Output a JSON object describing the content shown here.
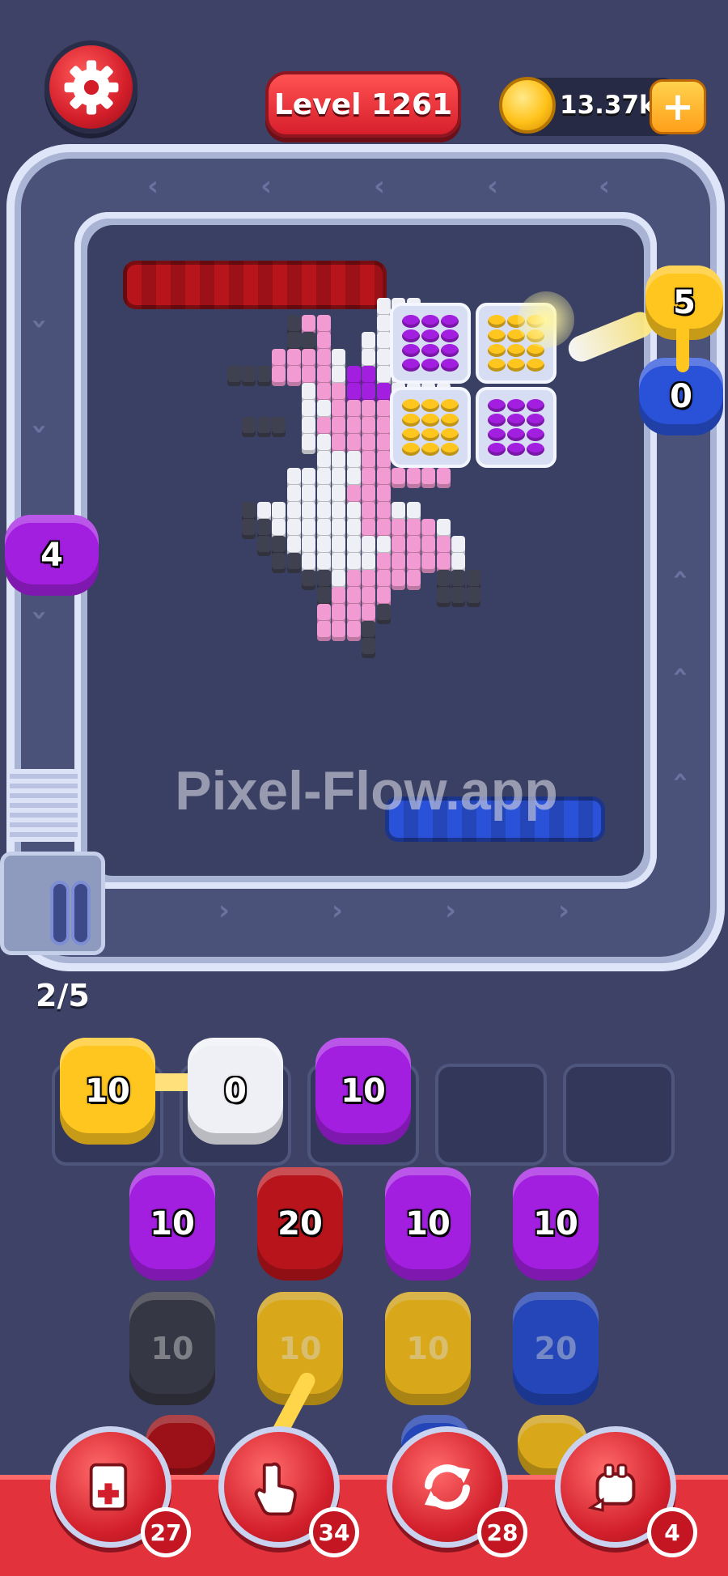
{
  "header": {
    "level_label": "Level 1261",
    "coins": "13.37k",
    "plus_symbol": "+"
  },
  "board": {
    "watermark": "Pixel-Flow.app",
    "slot_counter": "2/5"
  },
  "track_shooters": [
    {
      "color": "yellow",
      "count": "5"
    },
    {
      "color": "blue",
      "count": "0"
    },
    {
      "color": "purple",
      "count": "4"
    }
  ],
  "queue": [
    {
      "color": "yellow",
      "count": "10"
    },
    {
      "color": "white",
      "count": "0"
    },
    {
      "color": "purple",
      "count": "10"
    }
  ],
  "grid_row1": [
    {
      "color": "purple",
      "count": "10"
    },
    {
      "color": "red",
      "count": "20"
    },
    {
      "color": "purple",
      "count": "10"
    },
    {
      "color": "purple",
      "count": "10"
    }
  ],
  "grid_row2": [
    {
      "color": "gray",
      "count": "10"
    },
    {
      "color": "yellow",
      "count": "10"
    },
    {
      "color": "yellow",
      "count": "10"
    },
    {
      "color": "blue",
      "count": "20"
    }
  ],
  "boosters": [
    {
      "name": "add-slot-icon",
      "count": "27"
    },
    {
      "name": "hand-pick-icon",
      "count": "34"
    },
    {
      "name": "shuffle-icon",
      "count": "28"
    },
    {
      "name": "train-icon",
      "count": "4"
    }
  ],
  "colors": {
    "yellow": "#ffc61f",
    "white": "#eef0f6",
    "purple": "#a31fe0",
    "red": "#b8141c",
    "blue": "#2a52d8",
    "gray": "#3f4150",
    "pink": "#f29ad2"
  }
}
